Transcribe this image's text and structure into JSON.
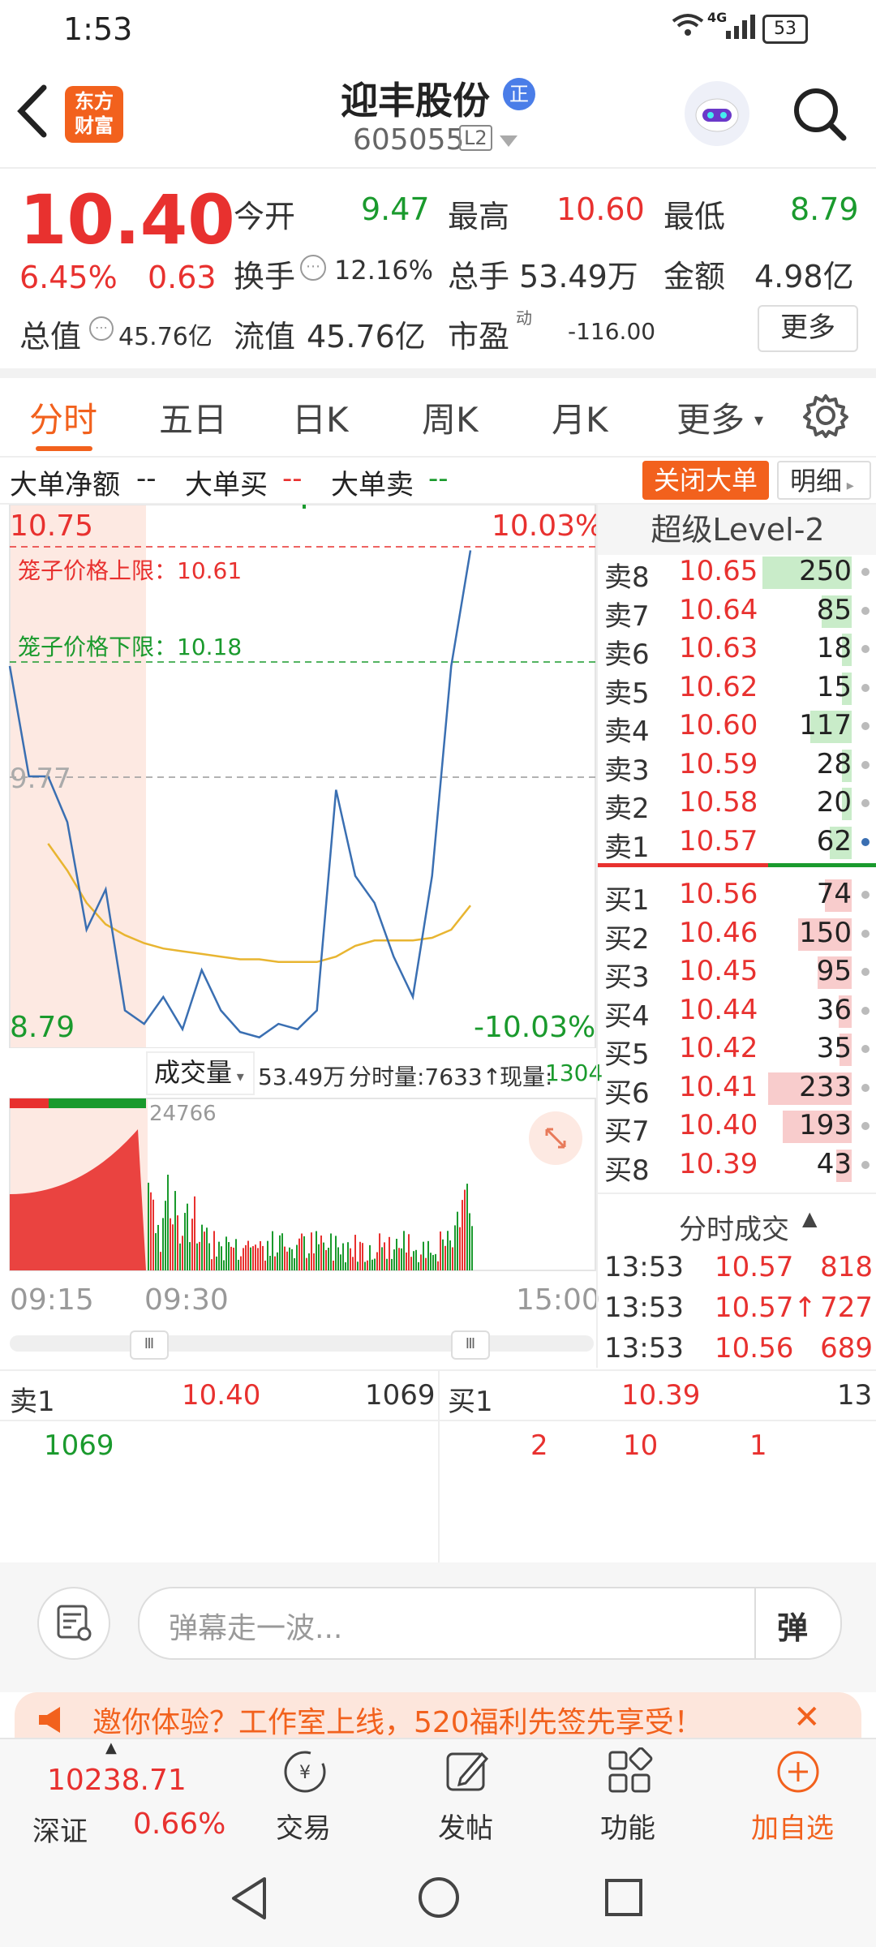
{
  "status": {
    "time": "1:53",
    "battery": "53",
    "network": "4G"
  },
  "header": {
    "app_logo": "东方\n财富",
    "stock_name": "迎丰股份",
    "stock_badge": "正",
    "stock_code": "605055",
    "level_badge": "L2"
  },
  "quote": {
    "price": "10.40",
    "change_pct": "6.45%",
    "change_amt": "0.63",
    "open_label": "今开",
    "open": "9.47",
    "high_label": "最高",
    "high": "10.60",
    "low_label": "最低",
    "low": "8.79",
    "turnover_label": "换手",
    "turnover": "12.16%",
    "volume_label": "总手",
    "volume": "53.49万",
    "amount_label": "金额",
    "amount": "4.98亿",
    "mktcap_label": "总值",
    "mktcap": "45.76亿",
    "float_label": "流值",
    "float": "45.76亿",
    "pe_label": "市盈",
    "pe_sup": "动",
    "pe": "-116.00",
    "more_label": "更多"
  },
  "tabs": [
    "分时",
    "五日",
    "日K",
    "周K",
    "月K",
    "更多"
  ],
  "bigorder": {
    "net_label": "大单净额",
    "net": "--",
    "buy_label": "大单买",
    "buy": "--",
    "sell_label": "大单卖",
    "sell": "--",
    "close_btn": "关闭大单",
    "detail_btn": "明细"
  },
  "chart": {
    "price_top": "10.75",
    "pct_top": "10.03%",
    "cage_upper": "笼子价格上限：10.61",
    "cage_lower": "笼子价格下限：10.18",
    "prev_close": "9.77",
    "price_bottom": "8.79",
    "pct_bottom": "-10.03%",
    "vol_selector": "成交量",
    "vol_total": "53.49万",
    "vol_fen": "分时量:7633↑",
    "vol_now_label": "现量:",
    "vol_now": "1304",
    "vol_peak": "24766",
    "time_start": "09:15",
    "time_mid": "09:30",
    "time_end": "15:00"
  },
  "chart_data": {
    "type": "line",
    "x": [
      "09:15",
      "09:25",
      "09:30",
      "09:35",
      "09:40",
      "09:45",
      "09:50",
      "10:00",
      "10:10",
      "10:20",
      "10:30",
      "10:40",
      "10:50",
      "11:00",
      "11:10",
      "11:20",
      "11:30",
      "13:00",
      "13:10",
      "13:20",
      "13:30",
      "13:40",
      "13:45",
      "13:50",
      "13:53"
    ],
    "series": [
      {
        "values": [
          10.18,
          9.77,
          9.77,
          9.6,
          9.2,
          9.35,
          8.9,
          8.85,
          8.95,
          8.83,
          9.05,
          8.9,
          8.82,
          8.8,
          8.85,
          8.83,
          8.9,
          9.72,
          9.4,
          9.3,
          9.1,
          8.95,
          9.4,
          10.18,
          10.61
        ]
      },
      {
        "values": [
          null,
          null,
          9.52,
          9.42,
          9.3,
          9.22,
          9.18,
          9.15,
          9.13,
          9.12,
          9.11,
          9.1,
          9.09,
          9.09,
          9.08,
          9.08,
          9.08,
          9.1,
          9.14,
          9.16,
          9.16,
          9.16,
          9.17,
          9.2,
          9.29
        ]
      }
    ],
    "ylim": [
      8.79,
      10.75
    ]
  },
  "orderbook": {
    "title": "超级Level-2",
    "sells": [
      {
        "label": "卖8",
        "price": "10.65",
        "vol": "250"
      },
      {
        "label": "卖7",
        "price": "10.64",
        "vol": "85"
      },
      {
        "label": "卖6",
        "price": "10.63",
        "vol": "18"
      },
      {
        "label": "卖5",
        "price": "10.62",
        "vol": "15"
      },
      {
        "label": "卖4",
        "price": "10.60",
        "vol": "117"
      },
      {
        "label": "卖3",
        "price": "10.59",
        "vol": "28"
      },
      {
        "label": "卖2",
        "price": "10.58",
        "vol": "20"
      },
      {
        "label": "卖1",
        "price": "10.57",
        "vol": "62"
      }
    ],
    "buys": [
      {
        "label": "买1",
        "price": "10.56",
        "vol": "74"
      },
      {
        "label": "买2",
        "price": "10.46",
        "vol": "150"
      },
      {
        "label": "买3",
        "price": "10.45",
        "vol": "95"
      },
      {
        "label": "买4",
        "price": "10.44",
        "vol": "36"
      },
      {
        "label": "买5",
        "price": "10.42",
        "vol": "35"
      },
      {
        "label": "买6",
        "price": "10.41",
        "vol": "233"
      },
      {
        "label": "买7",
        "price": "10.40",
        "vol": "193"
      },
      {
        "label": "买8",
        "price": "10.39",
        "vol": "43"
      }
    ],
    "ticks_title": "分时成交",
    "ticks": [
      {
        "time": "13:53",
        "price": "10.57",
        "vol": "818"
      },
      {
        "time": "13:53",
        "price": "10.57↑",
        "vol": "727"
      },
      {
        "time": "13:53",
        "price": "10.56",
        "vol": "689"
      }
    ]
  },
  "queue": {
    "sell_label": "卖1",
    "sell_price": "10.40",
    "sell_total": "1069",
    "sell_items": [
      "1069"
    ],
    "buy_label": "买1",
    "buy_price": "10.39",
    "buy_total": "13",
    "buy_items": [
      "2",
      "10",
      "1"
    ]
  },
  "comment": {
    "placeholder": "弹幕走一波...",
    "send": "弹"
  },
  "banner": {
    "text": "邀你体验？工作室上线，520福利先签先享受！"
  },
  "bottomnav": {
    "index_value": "10238.71",
    "index_name": "深证",
    "index_pct": "0.66%",
    "trade": "交易",
    "post": "发帖",
    "func": "功能",
    "add": "加自选"
  },
  "colors": {
    "up": "#e8312f",
    "down": "#1a9a2d",
    "accent": "#f2611d"
  }
}
